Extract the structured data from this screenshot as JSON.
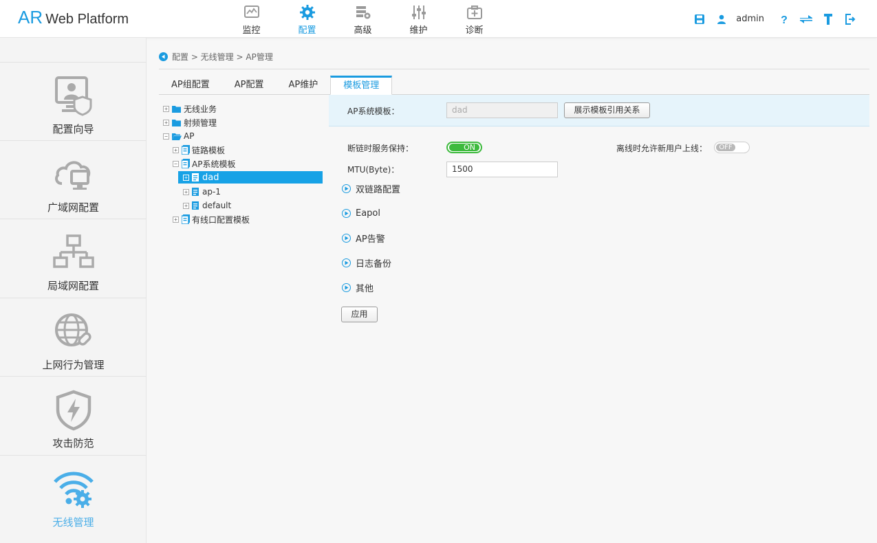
{
  "logo": {
    "ar": "AR",
    "platform": "Web Platform"
  },
  "topnav": [
    {
      "label": "监控",
      "icon": "monitor-icon"
    },
    {
      "label": "配置",
      "icon": "gear-icon"
    },
    {
      "label": "高级",
      "icon": "advanced-icon"
    },
    {
      "label": "维护",
      "icon": "maintenance-icon"
    },
    {
      "label": "诊断",
      "icon": "diagnosis-icon"
    }
  ],
  "topnav_active": "配置",
  "user": {
    "name": "admin"
  },
  "accent_color": "#1a9be0",
  "sidebar": {
    "items": [
      {
        "label": "配置向导",
        "icon": "wizard-icon"
      },
      {
        "label": "广域网配置",
        "icon": "wan-icon"
      },
      {
        "label": "局域网配置",
        "icon": "lan-icon"
      },
      {
        "label": "上网行为管理",
        "icon": "internet-behavior-icon"
      },
      {
        "label": "攻击防范",
        "icon": "shield-icon"
      },
      {
        "label": "无线管理",
        "icon": "wireless-icon"
      }
    ],
    "active": "无线管理"
  },
  "breadcrumb": "配置 > 无线管理 > AP管理",
  "tabs": [
    {
      "label": "AP组配置"
    },
    {
      "label": "AP配置"
    },
    {
      "label": "AP维护"
    },
    {
      "label": "模板管理"
    }
  ],
  "tabs_active": "模板管理",
  "tree": {
    "wireless_service": "无线业务",
    "radio_management": "射频管理",
    "ap": "AP",
    "link_template": "链路模板",
    "ap_system_template": "AP系统模板",
    "dad": "dad",
    "ap1": "ap-1",
    "default": "default",
    "wired_port_template": "有线口配置模板"
  },
  "form": {
    "template_label": "AP系统模板：",
    "template_value": "dad",
    "show_reference_button": "展示模板引用关系",
    "keep_service_label": "断链时服务保持：",
    "keep_service_state": "ON",
    "offline_new_user_label": "离线时允许新用户上线：",
    "offline_new_user_state": "OFF",
    "mtu_label": "MTU(Byte)：",
    "mtu_value": "1500",
    "sections": [
      "双链路配置",
      "Eapol",
      "AP告警",
      "日志备份",
      "其他"
    ],
    "apply_button": "应用"
  }
}
